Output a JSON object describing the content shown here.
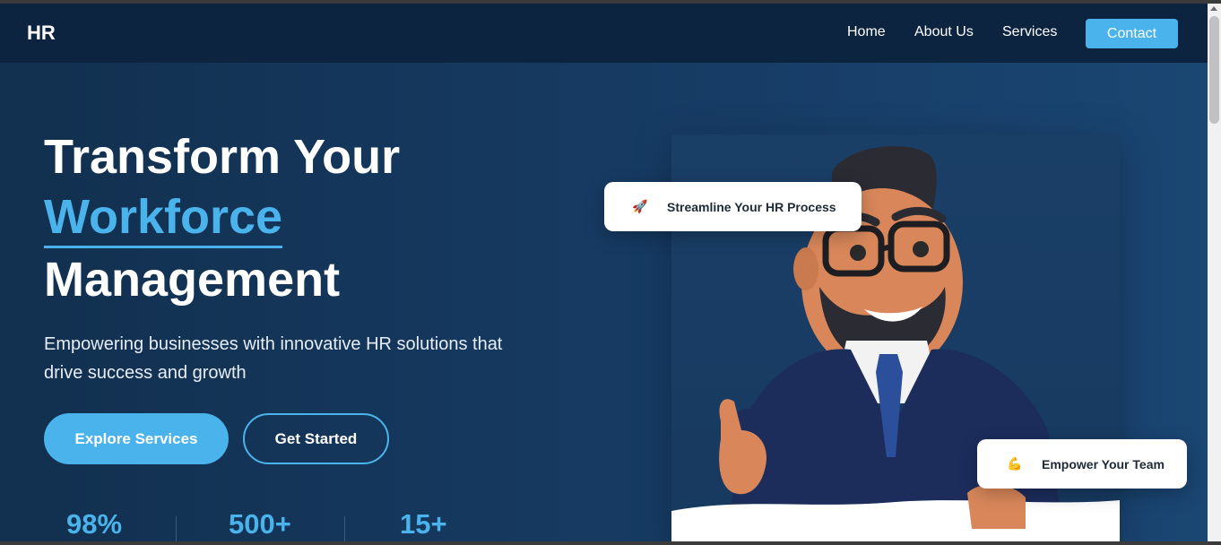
{
  "nav": {
    "logo": "HR",
    "links": [
      "Home",
      "About Us",
      "Services"
    ],
    "contact": "Contact"
  },
  "hero": {
    "headline_line1": "Transform Your",
    "headline_accent": "Workforce",
    "headline_line3": "Management",
    "subtitle": "Empowering businesses with innovative HR solutions that drive success and growth",
    "primary_button": "Explore Services",
    "secondary_button": "Get Started"
  },
  "stats": [
    "98%",
    "500+",
    "15+"
  ],
  "cards": {
    "top": {
      "icon": "rocket-icon",
      "emoji": "🚀",
      "label": "Streamline Your HR Process"
    },
    "bottom": {
      "icon": "flexed-biceps-icon",
      "emoji": "💪",
      "label": "Empower Your Team"
    }
  },
  "colors": {
    "accent": "#4ab3ec",
    "navbar": "#0d2440",
    "hero_bg": "#163a62"
  }
}
